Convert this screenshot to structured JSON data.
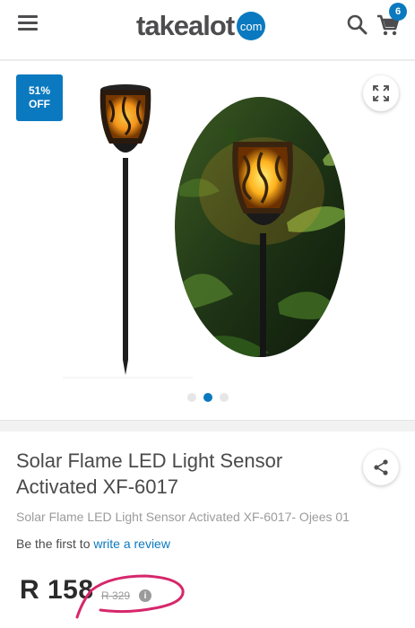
{
  "header": {
    "logo_text": "takealot",
    "logo_suffix": "com",
    "cart_count": "6"
  },
  "gallery": {
    "discount_percent": "51%",
    "discount_label": "OFF",
    "slide_count": 3,
    "active_slide": 2
  },
  "product": {
    "title": "Solar Flame LED Light Sensor Activated XF-6017",
    "subtitle": "Solar Flame LED Light Sensor Activated XF-6017- Ojees 01",
    "review_prefix": "Be the first to",
    "review_link": "write a review",
    "price": "R 158",
    "old_price": "R 329"
  },
  "colors": {
    "brand_blue": "#0b79bf",
    "scribble": "#d6276b"
  }
}
